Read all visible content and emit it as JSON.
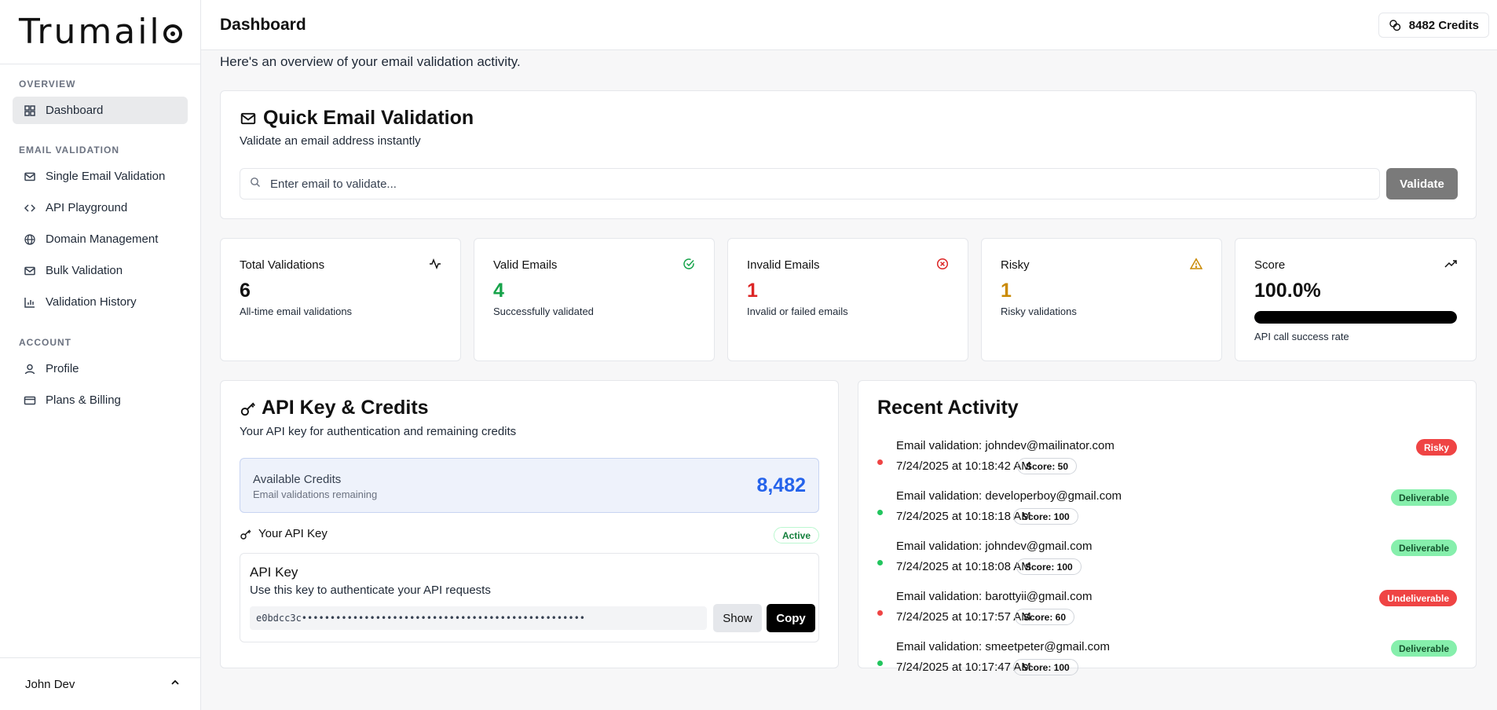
{
  "app": {
    "logo": "Trumail"
  },
  "sidebar": {
    "sections": [
      {
        "label": "OVERVIEW"
      },
      {
        "label": "EMAIL VALIDATION"
      },
      {
        "label": "ACCOUNT"
      }
    ],
    "items": [
      {
        "label": "Dashboard",
        "icon": "grid-icon",
        "active": true
      },
      {
        "label": "Single Email Validation",
        "icon": "mail-icon"
      },
      {
        "label": "API Playground",
        "icon": "code-icon"
      },
      {
        "label": "Domain Management",
        "icon": "globe-icon"
      },
      {
        "label": "Bulk Validation",
        "icon": "mail-icon"
      },
      {
        "label": "Validation History",
        "icon": "bar-chart-icon"
      },
      {
        "label": "Profile",
        "icon": "user-icon"
      },
      {
        "label": "Plans & Billing",
        "icon": "credit-card-icon"
      }
    ],
    "user": {
      "name": "John Dev"
    }
  },
  "header": {
    "title": "Dashboard",
    "credits": "8482 Credits"
  },
  "main": {
    "subtitle": "Here's an overview of your email validation activity.",
    "quick_validation": {
      "title": "Quick Email Validation",
      "subtitle": "Validate an email address instantly",
      "placeholder": "Enter email to validate...",
      "button": "Validate"
    },
    "stats": [
      {
        "title": "Total Validations",
        "value": "6",
        "desc": "All-time email validations",
        "icon": "activity-icon",
        "color": "#111111"
      },
      {
        "title": "Valid Emails",
        "value": "4",
        "desc": "Successfully validated",
        "icon": "check-circle-icon",
        "color": "#16a34a"
      },
      {
        "title": "Invalid Emails",
        "value": "1",
        "desc": "Invalid or failed emails",
        "icon": "x-circle-icon",
        "color": "#dc2626"
      },
      {
        "title": "Risky",
        "value": "1",
        "desc": "Risky validations",
        "icon": "warning-icon",
        "color": "#ca8a04"
      },
      {
        "title": "Score",
        "value": "100.0%",
        "desc": "API call success rate",
        "icon": "trending-up-icon",
        "color": "#111111",
        "progress": 1.0
      }
    ],
    "api": {
      "title": "API Key & Credits",
      "subtitle": "Your API key for authentication and remaining credits",
      "available_label": "Available Credits",
      "available_sub": "Email validations remaining",
      "available_value": "8,482",
      "your_key_label": "Your API Key",
      "status": "Active",
      "key_title": "API Key",
      "key_sub": "Use this key to authenticate your API requests",
      "key_value": "e0bdcc3c••••••••••••••••••••••••••••••••••••••••••••••••••",
      "show": "Show",
      "copy": "Copy"
    },
    "recent": {
      "title": "Recent Activity",
      "items": [
        {
          "title": "Email validation: johndev@mailinator.com",
          "time": "7/24/2025 at 10:18:42 AM",
          "score": "Score: 50",
          "status": "Risky",
          "kind": "risky",
          "dot": "#ef4444"
        },
        {
          "title": "Email validation: developerboy@gmail.com",
          "time": "7/24/2025 at 10:18:18 AM",
          "score": "Score: 100",
          "status": "Deliverable",
          "kind": "deliverable",
          "dot": "#22c55e"
        },
        {
          "title": "Email validation: johndev@gmail.com",
          "time": "7/24/2025 at 10:18:08 AM",
          "score": "Score: 100",
          "status": "Deliverable",
          "kind": "deliverable",
          "dot": "#22c55e"
        },
        {
          "title": "Email validation: barottyii@gmail.com",
          "time": "7/24/2025 at 10:17:57 AM",
          "score": "Score: 60",
          "status": "Undeliverable",
          "kind": "undeliverable",
          "dot": "#ef4444"
        },
        {
          "title": "Email validation: smeetpeter@gmail.com",
          "time": "7/24/2025 at 10:17:47 AM",
          "score": "Score: 100",
          "status": "Deliverable",
          "kind": "deliverable",
          "dot": "#22c55e"
        }
      ]
    }
  }
}
